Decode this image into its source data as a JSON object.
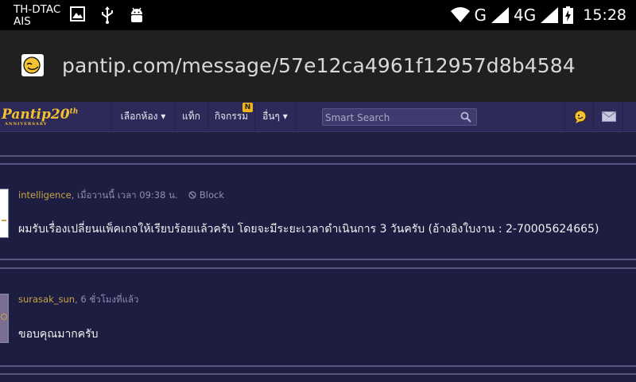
{
  "status_bar": {
    "carrier_line1": "TH-DTAC",
    "carrier_line2": "AIS",
    "network_g": "G",
    "network_4g": "4G",
    "time": "15:28"
  },
  "url_bar": {
    "url": "pantip.com/message/57e12ca4961f12957d8b4584"
  },
  "navbar": {
    "logo_text": "Pantip20",
    "logo_sup": "th",
    "logo_sub": "ANNIVERSARY",
    "items": [
      {
        "label": "เลือกห้อง ▾"
      },
      {
        "label": "แท็ก"
      },
      {
        "label": "กิจกรรม"
      },
      {
        "label": "อื่นๆ ▾"
      }
    ],
    "activity_badge": "N",
    "search_placeholder": "Smart Search"
  },
  "messages": [
    {
      "user": "intelligence",
      "time": ", เมื่อวานนี้ เวลา 09:38 น.",
      "block_label": "Block",
      "text": "ผมรับเรื่องเปลี่ยนแพ็คเกจให้เรียบร้อยแล้วครับ โดยจะมีระยะเวลาดำเนินการ 3 วันครับ (อ้างอิงใบงาน : 2-70005624665)"
    },
    {
      "user": "surasak_sun",
      "time": ", 6 ชั่วโมงที่แล้ว",
      "text": "ขอบคุณมากครับ"
    }
  ],
  "colors": {
    "background": "#1f1f42",
    "navbar": "#2d2a5a",
    "username": "#c9a447",
    "logo": "#f2c230"
  }
}
